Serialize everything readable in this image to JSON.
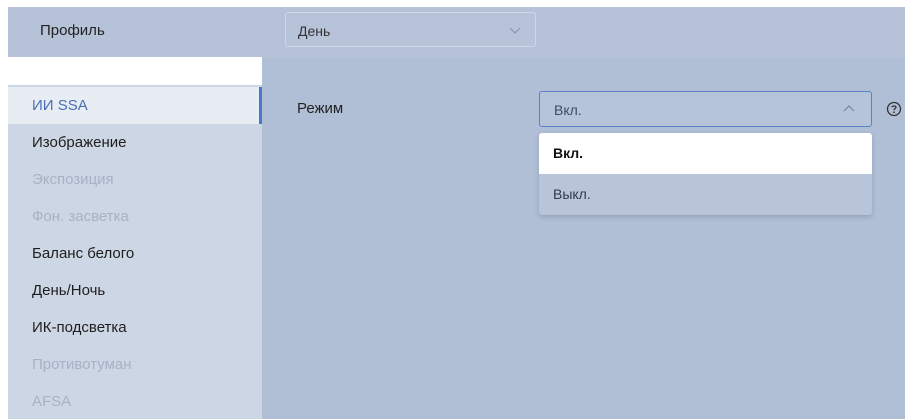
{
  "header": {
    "profile_label": "Профиль",
    "profile_value": "День"
  },
  "sidebar": {
    "items": [
      {
        "label": "ИИ SSA",
        "state": "active"
      },
      {
        "label": "Изображение",
        "state": "enabled"
      },
      {
        "label": "Экспозиция",
        "state": "disabled"
      },
      {
        "label": "Фон. засветка",
        "state": "disabled"
      },
      {
        "label": "Баланс белого",
        "state": "enabled"
      },
      {
        "label": "День/Ночь",
        "state": "enabled"
      },
      {
        "label": "ИК-подсветка",
        "state": "enabled"
      },
      {
        "label": "Противотуман",
        "state": "disabled"
      },
      {
        "label": "AFSA",
        "state": "disabled"
      }
    ]
  },
  "main": {
    "mode_label": "Режим",
    "mode_value": "Вкл.",
    "options": [
      {
        "label": "Вкл.",
        "selected": true
      },
      {
        "label": "Выкл.",
        "selected": false
      }
    ]
  },
  "icons": {
    "profile_chevron": "chevron-down-icon",
    "mode_chevron": "chevron-up-icon",
    "help": "help-circle-icon"
  },
  "colors": {
    "accent": "#4a78d0",
    "active_text": "#4a6fb5",
    "disabled_text": "#a7b2c5"
  }
}
